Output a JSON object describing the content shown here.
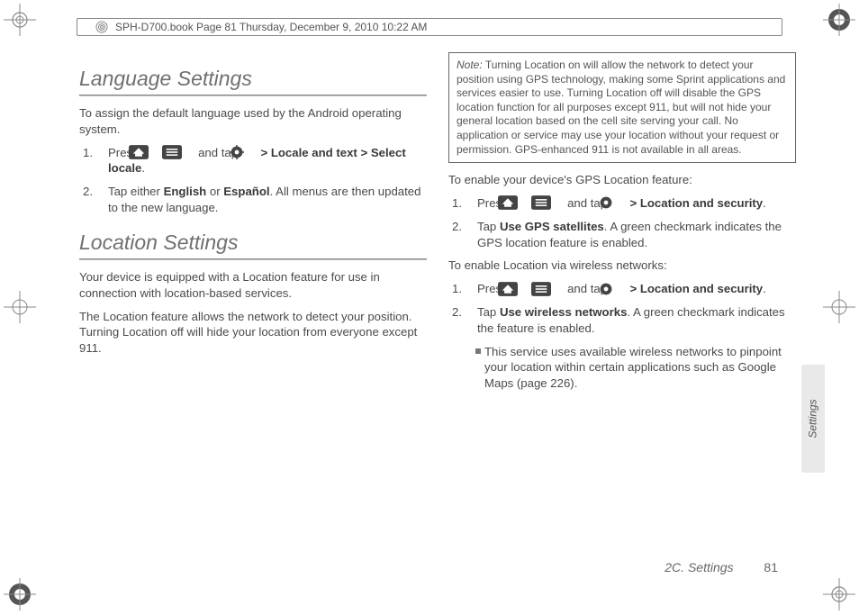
{
  "header": {
    "text": "SPH-D700.book  Page 81  Thursday, December 9, 2010  10:22 AM"
  },
  "section1": {
    "title": "Language Settings",
    "intro": "To assign the default language used by the Android operating system.",
    "step1_a": "Press ",
    "step1_b": " and tap ",
    "step1_c": "Locale and text",
    "step1_d": "Select locale",
    "step2_a": "Tap either ",
    "step2_b": "English",
    "step2_c": " or ",
    "step2_d": "Español",
    "step2_e": ". All menus are then updated to the new language."
  },
  "section2": {
    "title": "Location Settings",
    "p1": "Your device is equipped with a Location feature for use in connection with location-based services.",
    "p2": "The Location feature allows the network to detect your position. Turning Location off will hide your location from everyone except 911."
  },
  "note": {
    "label": "Note:",
    "body": "Turning Location on will allow the network to detect your position using GPS technology, making some Sprint applications and services easier to use. Turning Location off will disable the GPS location function for all purposes except 911, but will not hide your general location based on the cell site serving your call. No application or service may use your location without your request or permission. GPS-enhanced 911 is not available in all areas."
  },
  "gps": {
    "heading": "To enable your device's GPS Location feature:",
    "step1_a": "Press ",
    "step1_b": " and tap ",
    "step1_c": "Location and security",
    "step2_a": "Tap ",
    "step2_b": "Use GPS satellites",
    "step2_c": ". A green checkmark indicates the GPS location feature is enabled."
  },
  "wireless": {
    "heading": "To enable Location via wireless networks:",
    "step1_a": "Press ",
    "step1_b": " and tap ",
    "step1_c": "Location and security",
    "step2_a": "Tap ",
    "step2_b": "Use wireless networks",
    "step2_c": ". A green checkmark indicates the feature is enabled.",
    "bullet": "This service uses available wireless networks to pinpoint your location within certain applications such as Google Maps (page 226)."
  },
  "sideTab": "Settings",
  "footer": {
    "section": "2C. Settings",
    "page": "81"
  },
  "glyphs": {
    "gt": ">",
    "n1": "1.",
    "n2": "2.",
    "period": "."
  }
}
